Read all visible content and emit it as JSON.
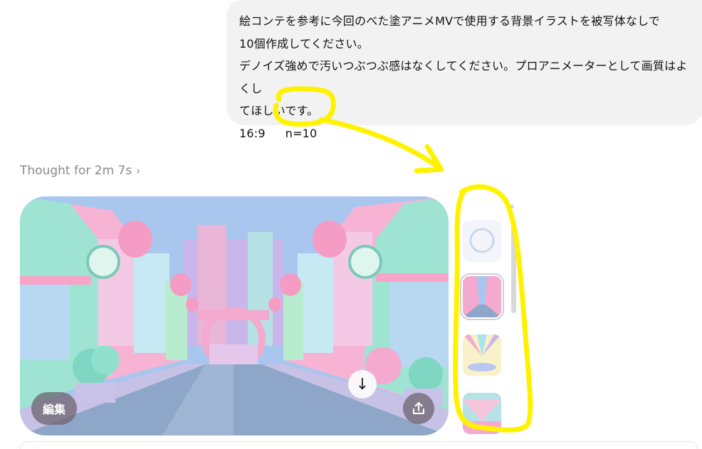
{
  "message": {
    "lines": [
      "絵コンテを参考に今回のべた塗アニメMVで使用する背景イラストを被写体なしで",
      "10個作成してください。",
      "デノイズ強めで汚いつぶつぶ感はなくしてください。プロアニメーターとして画質はよくし",
      "てほしいです。"
    ],
    "aspect": "16:9",
    "count": "n=10"
  },
  "thought": {
    "label": "Thought for 2m 7s",
    "chevron": "›"
  },
  "image_actions": {
    "edit_label": "編集",
    "download_icon": "arrow-down-icon",
    "share_icon": "share-icon"
  },
  "colors": {
    "bubble": "#f2f2f2",
    "highlight": "#fff200",
    "sky": "#a9c6ef",
    "pink": "#f4a9cf",
    "mint": "#9fe3d3"
  }
}
